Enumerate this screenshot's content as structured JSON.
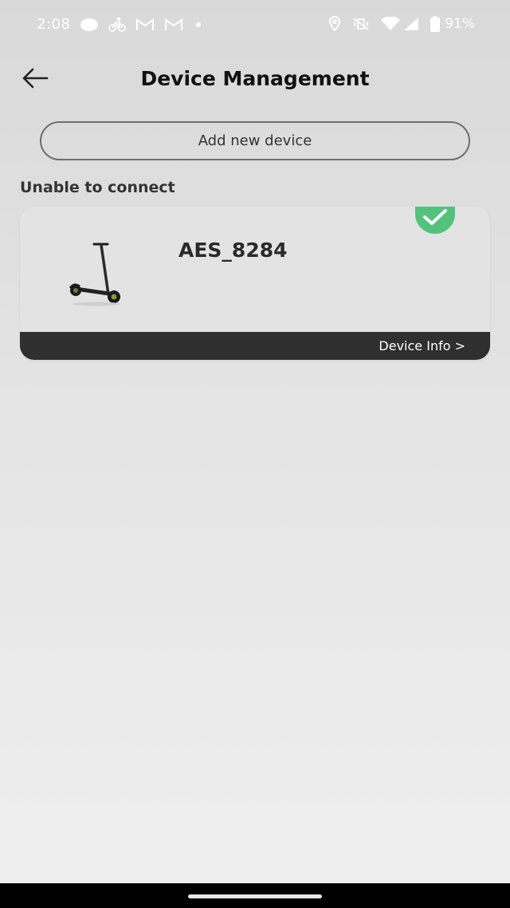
{
  "status_bar": {
    "time": "2:08",
    "battery": "91%",
    "icons": [
      "cloud-icon",
      "bike-icon",
      "gmail-icon",
      "gmail-icon",
      "dot-icon",
      "location-icon",
      "vibrate-off-icon",
      "wifi-icon",
      "signal-icon",
      "battery-icon"
    ]
  },
  "header": {
    "title": "Device Management",
    "back_icon": "back-arrow-icon"
  },
  "add_device": {
    "label": "Add new device"
  },
  "section": {
    "label": "Unable to connect"
  },
  "device": {
    "name": "AES_8284",
    "info_link": "Device Info >",
    "selected": true,
    "badge_color": "#52c27d"
  },
  "colors": {
    "info_bar": "#2f2f2f",
    "accent_green": "#52c27d"
  }
}
